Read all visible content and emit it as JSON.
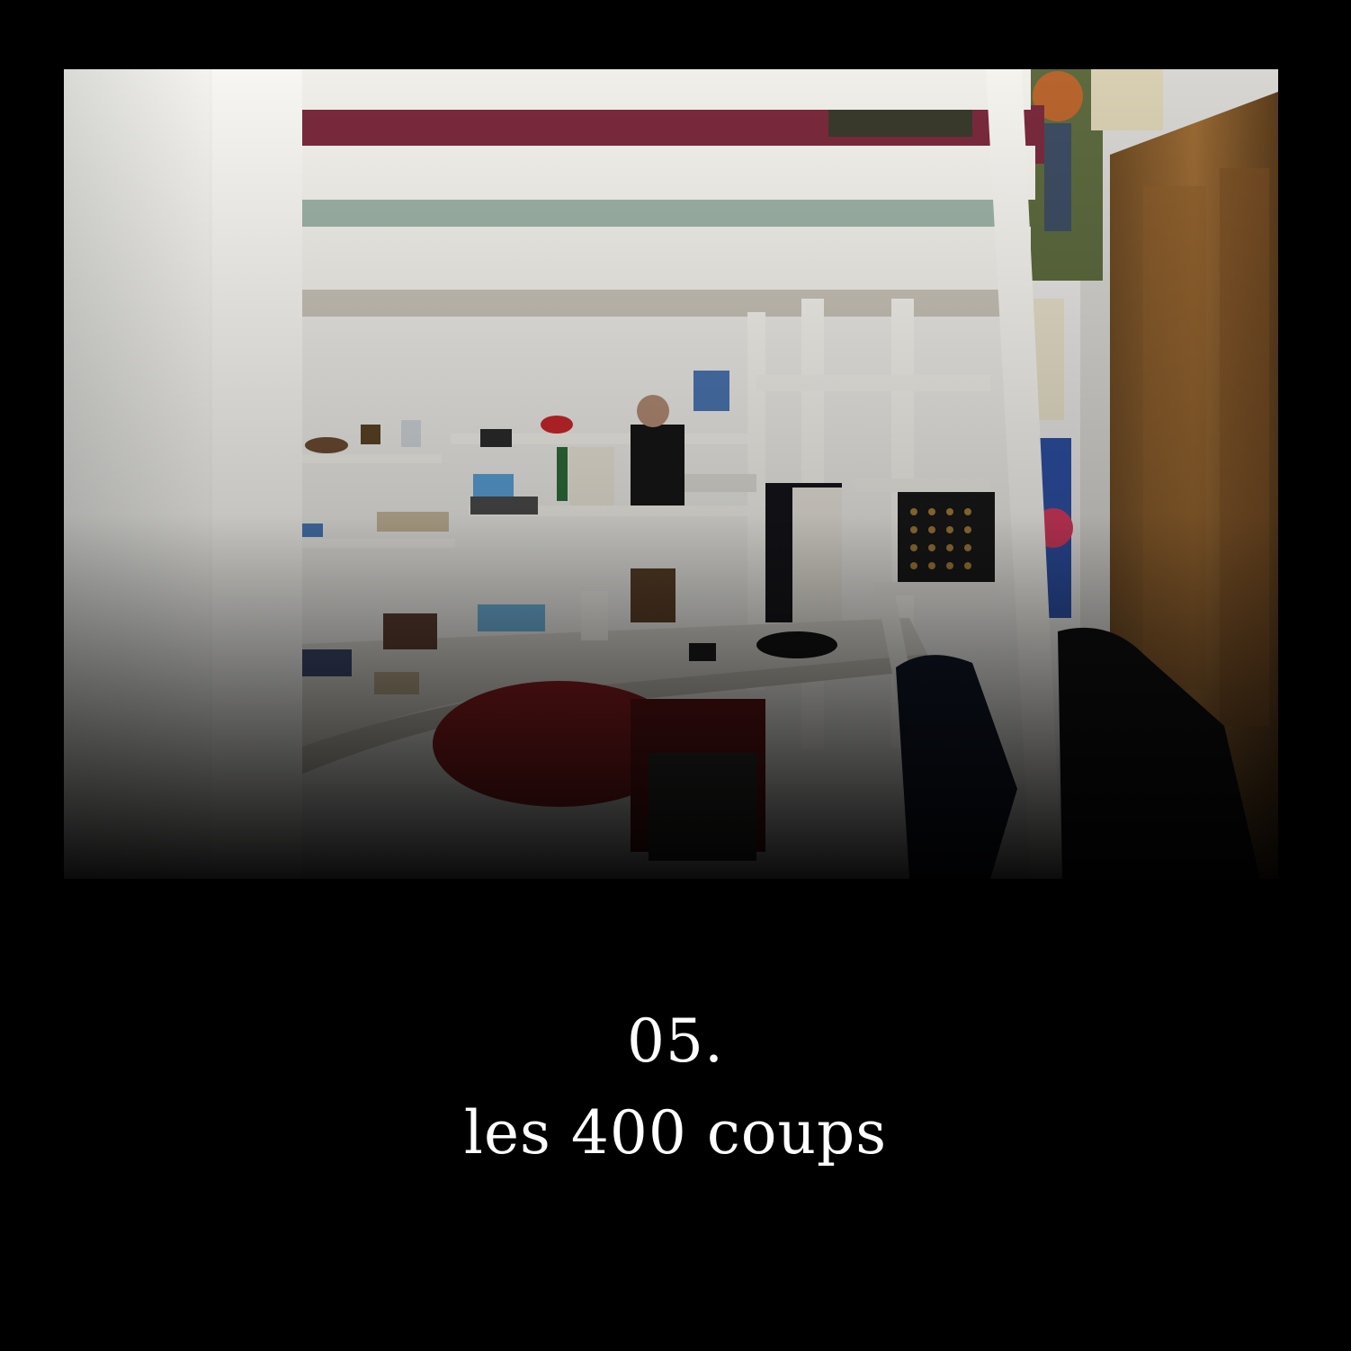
{
  "caption": {
    "number": "05.",
    "title": "les 400 coups"
  }
}
